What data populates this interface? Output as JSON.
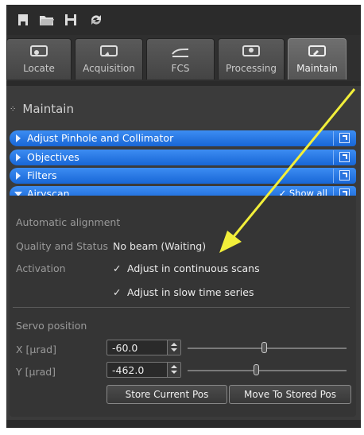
{
  "colors": {
    "accent_bar": "#1f74e2",
    "annotation_arrow": "#f2ef3a",
    "panel_bg": "#3b3b3b"
  },
  "toolbar": {
    "icons": [
      "save-small-icon",
      "open-folder-icon",
      "save-disk-icon",
      "reuse-icon"
    ]
  },
  "tabs": [
    {
      "label": "Locate",
      "icon": "locate-icon"
    },
    {
      "label": "Acquisition",
      "icon": "acquisition-icon"
    },
    {
      "label": "FCS",
      "icon": "fcs-icon"
    },
    {
      "label": "Processing",
      "icon": "processing-icon"
    },
    {
      "label": "Maintain",
      "icon": "maintain-icon",
      "active": true
    }
  ],
  "panel": {
    "title": "Maintain",
    "sections": [
      {
        "label": "Adjust Pinhole and Collimator",
        "expanded": false
      },
      {
        "label": "Objectives",
        "expanded": false
      },
      {
        "label": "Filters",
        "expanded": false
      },
      {
        "label": "Airyscan",
        "expanded": true,
        "show_all_label": "Show all",
        "show_all_checked": true
      }
    ]
  },
  "airyscan": {
    "automatic_alignment_label": "Automatic alignment",
    "quality_label": "Quality and Status",
    "quality_value": "No beam (Waiting)",
    "activation_label": "Activation",
    "checkbox_continuous": "Adjust in continuous scans",
    "checkbox_slow": "Adjust in slow time series",
    "servo_label": "Servo position",
    "x_label": "X [µrad]",
    "x_value": "-60.0",
    "x_slider_fraction": 0.48,
    "y_label": "Y [µrad]",
    "y_value": "-462.0",
    "y_slider_fraction": 0.43,
    "store_button": "Store Current Pos",
    "move_button": "Move To Stored Pos"
  }
}
